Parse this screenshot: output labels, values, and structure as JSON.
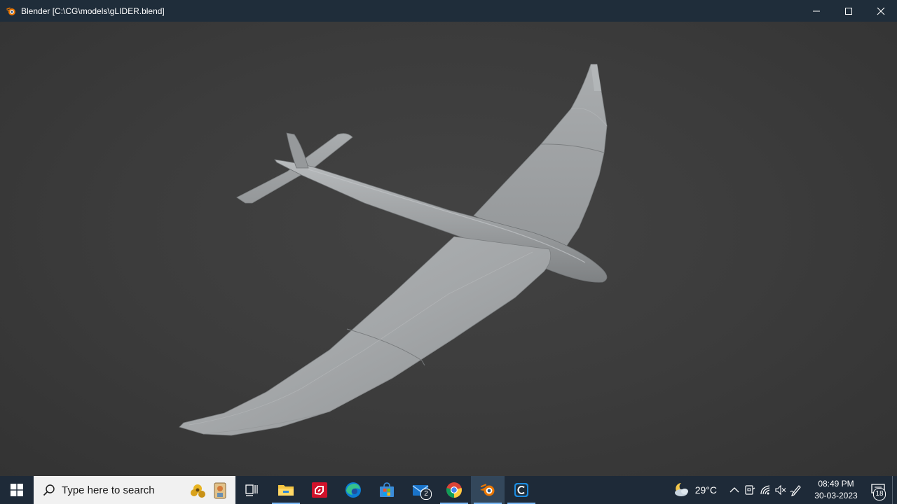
{
  "window": {
    "title": "Blender [C:\\CG\\models\\gLIDER.blend]",
    "controls": {
      "minimize": "minimize",
      "maximize": "maximize",
      "close": "close"
    }
  },
  "viewport": {
    "background_color": "#3a3a3a",
    "model_color": "#a6a9ab"
  },
  "taskbar": {
    "search_placeholder": "Type here to search",
    "apps": [
      {
        "name": "task-view",
        "badge": ""
      },
      {
        "name": "file-explorer",
        "badge": ""
      },
      {
        "name": "amd-software",
        "badge": ""
      },
      {
        "name": "microsoft-edge",
        "badge": ""
      },
      {
        "name": "microsoft-store",
        "badge": ""
      },
      {
        "name": "mail",
        "badge": "2"
      },
      {
        "name": "google-chrome",
        "badge": ""
      },
      {
        "name": "blender",
        "badge": ""
      },
      {
        "name": "cortana-c",
        "badge": ""
      }
    ],
    "tray": {
      "temperature": "29°C",
      "time": "08:49 PM",
      "date": "30-03-2023",
      "notifications": "18"
    }
  },
  "colors": {
    "titlebar": "#1f2d3a",
    "taskbar": "#1e2a38",
    "accent": "#7ab8f5"
  }
}
